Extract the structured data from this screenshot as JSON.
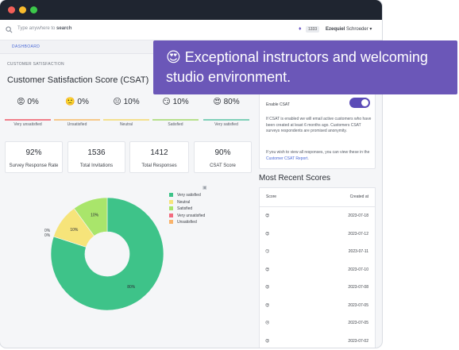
{
  "topbar": {
    "search_prefix": "Type anywhere to ",
    "search_bold": "search",
    "notification_count": "1333",
    "user_first": "Ezequiel",
    "user_last": "Schroeder"
  },
  "nav": {
    "active_tab": "DASHBOARD"
  },
  "main": {
    "section_label": "CUSTOMER SATISFACTION",
    "title": "Customer Satisfaction Score (CSAT)",
    "scores": [
      {
        "emoji": "😡",
        "value": "0%",
        "label": "Very unsatisfied",
        "color": "#f07f8a"
      },
      {
        "emoji": "🙁",
        "value": "0%",
        "label": "Unsatisfied",
        "color": "#f6c98a"
      },
      {
        "emoji": "😐",
        "value": "10%",
        "label": "Neutral",
        "color": "#f4e08e"
      },
      {
        "emoji": "😏",
        "value": "10%",
        "label": "Satisfied",
        "color": "#b7e08c"
      },
      {
        "emoji": "😍",
        "value": "80%",
        "label": "Very satisfied",
        "color": "#7fd0b8"
      }
    ],
    "stats": [
      {
        "value": "92%",
        "label": "Survey Response Rate"
      },
      {
        "value": "1536",
        "label": "Total Invitations"
      },
      {
        "value": "1412",
        "label": "Total Responses"
      },
      {
        "value": "90%",
        "label": "CSAT Score"
      }
    ]
  },
  "chart_data": {
    "type": "pie",
    "donut": true,
    "categories": [
      "Very satisfied",
      "Neutral",
      "Satisfied",
      "Very unsatisfied",
      "Unsatisfied"
    ],
    "values": [
      80,
      10,
      10,
      0,
      0
    ],
    "colors": [
      "#3ec389",
      "#f6e47a",
      "#a9e56b",
      "#f36b7f",
      "#f9b36b"
    ],
    "data_labels": [
      "80%",
      "10%",
      "10%",
      "0%",
      "0%"
    ],
    "legend_position": "top-right"
  },
  "settings_card": {
    "enable_label": "Enable CSAT",
    "enabled": true,
    "desc1": "If CSAT is enabled we will email active customers who have been created at least 6 months ago. Customers CSAT surveys respondents are promised anonymity.",
    "desc2_prefix": "If you wish to view all responses, you can view these in the ",
    "desc2_link": "Customer CSAT Report",
    "desc2_suffix": "."
  },
  "recent": {
    "title": "Most Recent Scores",
    "col_score": "Score",
    "col_created": "Created at",
    "rows": [
      {
        "emoji": "😍",
        "date": "2023-07-18"
      },
      {
        "emoji": "😍",
        "date": "2023-07-12"
      },
      {
        "emoji": "😏",
        "date": "2023-07-11"
      },
      {
        "emoji": "😍",
        "date": "2023-07-10"
      },
      {
        "emoji": "😍",
        "date": "2023-07-08"
      },
      {
        "emoji": "😍",
        "date": "2023-07-05"
      },
      {
        "emoji": "😐",
        "date": "2023-07-05"
      },
      {
        "emoji": "😍",
        "date": "2023-07-02"
      }
    ]
  },
  "banner": {
    "text": "😍 Exceptional instructors and welcoming studio environment."
  }
}
